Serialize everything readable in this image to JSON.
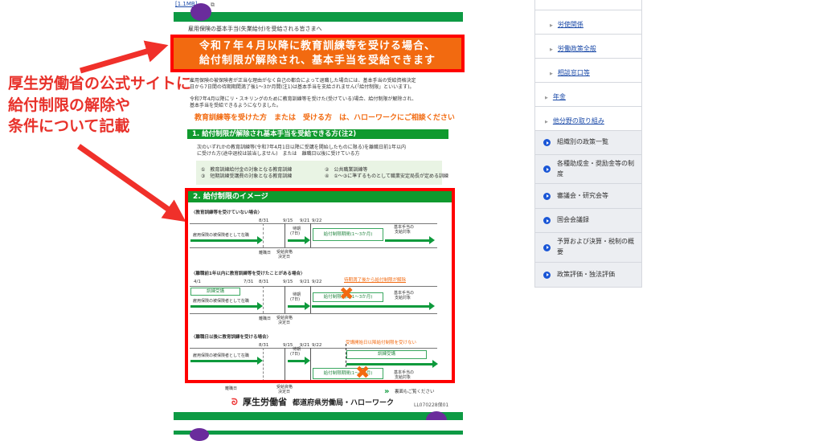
{
  "annotation": {
    "lines": [
      "厚生労働省の公式サイトに",
      "給付制限の解除や",
      "条件について記載"
    ]
  },
  "doc": {
    "file_link": "[1.1MB]",
    "greeting": "雇用保険の基本手当(失業給付)を受給される皆さまへ",
    "headline": [
      "令和７年４月以降に教育訓練等を受ける場合、",
      "給付制限が解除され、基本手当を受給できます"
    ],
    "para1": [
      "雇用保険の被保険者が正当な理由がなく自己の都合によって退職した場合には、基本手当の受給資格決定",
      "日から7日間の待期期間満了後1～3か月間(注1)は基本手当を支給されません(「給付制限」といいます)。"
    ],
    "para2": [
      "令和7年4月以降にリ・スキリングのために教育訓練等を受けた(受けている)場合、給付制限が解除され、",
      "基本手当を受給できるようになりました。"
    ],
    "consult": "教育訓練等を受けた方　または　受ける方　は、ハローワークにご相談ください",
    "section1_title": "1. 給付制限が解除され基本手当を受給できる方(注2)",
    "section1_text": [
      "次のいずれかの教育訓練等(令和7年4月1日以降に受講を開始したものに限る)を離職日前1年以内",
      "に受けた方(途中退校は該当しません)　または　離職日以後に受けている方"
    ],
    "training_types": [
      "①　教育訓練給付金の対象となる教育訓練",
      "②　公共職業訓練等",
      "③　短期訓練受講費の対象となる教育訓練",
      "④　①～③に準ずるものとして職業安定局長が定める訓練"
    ],
    "section2_title": "2. 給付制限のイメージ",
    "scenarios": [
      {
        "title": "〈教育訓練等を受けていない場合〉",
        "dates": [
          "8/31",
          "9/15",
          "9/21",
          "9/22"
        ]
      },
      {
        "title": "〈離職前1年以内に教育訓練等を受けたことがある場合〉",
        "dates": [
          "4/1",
          "7/31",
          "8/31",
          "9/15",
          "9/21",
          "9/22"
        ],
        "note": "待期満了後から給付制限が解除",
        "training": "訓練受講"
      },
      {
        "title": "〈離職日以後に教育訓練を受ける場合〉",
        "dates": [
          "8/31",
          "9/15",
          "9/21",
          "9/22"
        ],
        "note": "受講開始日以降給付制限を受けない",
        "training": "訓練受講"
      }
    ],
    "labels": {
      "employed": "雇用保険の被保険者として在職",
      "waiting": "待期",
      "waiting_days": "(7日)",
      "restriction": "給付制限期間(1～3か月)",
      "restriction_short": "給付制限",
      "period": "期間(1～3か月)",
      "benefit": "基本手当の",
      "benefit2": "支給対象",
      "leave_day": "離職日",
      "decision": "受給資格",
      "decision2": "決定日"
    },
    "see_back": "裏面もご覧ください",
    "ministry": "厚生労働省",
    "office": "都道府県労働局・ハローワーク",
    "code": "LL070228保01"
  },
  "sidebar": {
    "sub_items": [
      "労使関係",
      "労働政策全般",
      "相談窓口等"
    ],
    "items": [
      "年金",
      "他分野の取り組み"
    ],
    "policy_items": [
      "組織別の政策一覧",
      "各種助成金・奨励金等の制度",
      "審議会・研究会等",
      "国会会議録",
      "予算および決算・税制の概要",
      "政策評価・独法評価"
    ]
  },
  "colors": {
    "orange": "#f26a10",
    "green": "#109a2e",
    "red": "#ff0000",
    "purple": "#6a2c9c"
  }
}
